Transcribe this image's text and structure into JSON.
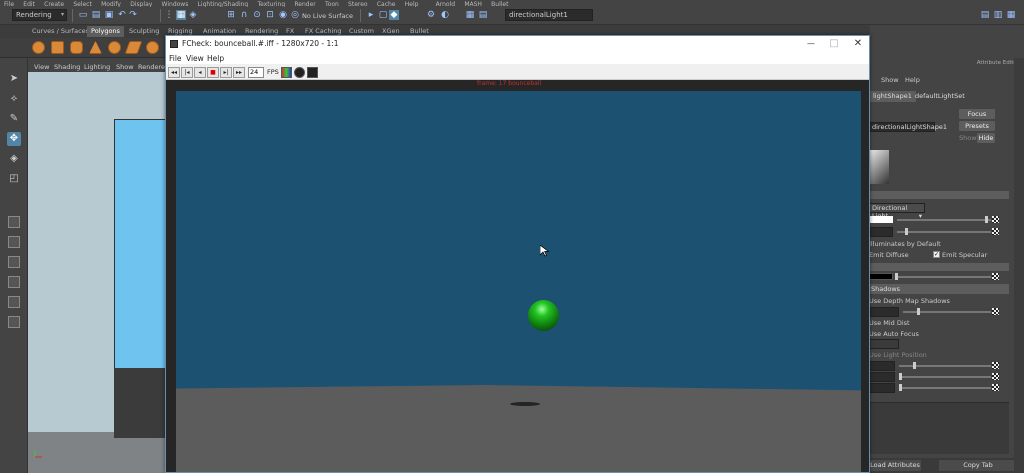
{
  "maya": {
    "menubar": [
      "File",
      "Edit",
      "Create",
      "Select",
      "Modify",
      "Display",
      "Windows",
      "Lighting/Shading",
      "Texturing",
      "Render",
      "Toon",
      "Stereo",
      "Cache",
      "Help"
    ],
    "menubar_right": [
      "Arnold",
      "MASH",
      "Bullet"
    ],
    "menuset": "Rendering",
    "live_surface": "No Live Surface",
    "selected_object_field": "directionalLight1",
    "shelf_tabs": [
      "Curves / Surfaces",
      "Polygons",
      "Sculpting",
      "Rigging",
      "Animation",
      "Rendering",
      "FX",
      "FX Caching",
      "Custom",
      "XGen",
      "Bullet"
    ],
    "active_shelf_tab": "Polygons",
    "viewport_menu": [
      "View",
      "Shading",
      "Lighting",
      "Show",
      "Rendere"
    ]
  },
  "attribute_editor": {
    "title": "Attribute Editor",
    "menu": [
      "Show",
      "Help"
    ],
    "tabs": [
      "lightShape1",
      "defaultLightSet"
    ],
    "shape_field": "directionalLightShape1",
    "buttons": {
      "focus": "Focus",
      "presets": "Presets",
      "show": "Show",
      "hide": "Hide"
    },
    "type_value": "Directional Light",
    "rows": {
      "illuminates": "Illuminates by Default",
      "emit_diffuse": "Emit Diffuse",
      "emit_specular": "Emit Specular",
      "shadows_section": "Shadows",
      "use_depth_map": "Use Depth Map Shadows",
      "use_mid_dist": "Use Mid Dist",
      "use_auto_focus": "Use Auto Focus",
      "use_light_position": "Use Light Position"
    },
    "bottom_buttons": [
      "Load Attributes",
      "Copy Tab"
    ],
    "colors": {
      "light_color": "#ffffff",
      "shadow_color": "#000000"
    }
  },
  "fcheck": {
    "title": "FCheck: bounceball.#.iff - 1280x720 - 1:1",
    "menu": [
      "File",
      "View",
      "Help"
    ],
    "fps_value": "24",
    "fps_label": "FPS",
    "stamp": "frame: 17 bounceball",
    "window_controls": {
      "minimize": "—",
      "maximize": "□",
      "close": "✕"
    },
    "colors": {
      "sky": "#1c5172",
      "ground": "#5c5c5c",
      "ball": "#22c322"
    }
  },
  "icons": [
    "select-arrow-icon",
    "lasso-icon",
    "paint-select-icon",
    "move-icon",
    "rotate-icon",
    "scale-icon",
    "play-backward-icon",
    "play-forward-icon",
    "stop-icon",
    "step-icon",
    "close-icon",
    "mouse-cursor-icon"
  ]
}
